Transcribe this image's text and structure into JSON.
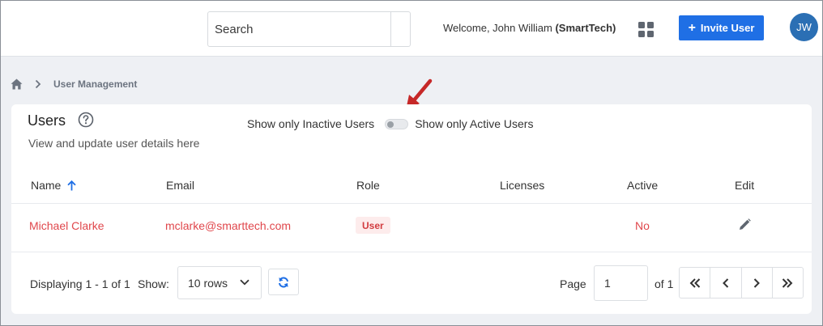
{
  "header": {
    "search": {
      "placeholder": "Search",
      "value": ""
    },
    "welcome_prefix": "Welcome, John William ",
    "welcome_org": "(SmartTech)",
    "apps_icon": "grid-icon",
    "invite_plus": "+",
    "invite_label": "Invite User",
    "avatar_initials": "JW",
    "accent_color": "#1f6fe5"
  },
  "breadcrumb": {
    "home_icon": "home-icon",
    "current": "User Management"
  },
  "card": {
    "title": "Users",
    "subtitle": "View and update user details here",
    "toggle": {
      "left_label": "Show only Inactive Users",
      "right_label": "Show only Active Users",
      "state": "inactive"
    }
  },
  "table": {
    "columns": [
      "Name",
      "Email",
      "Role",
      "Licenses",
      "Active",
      "Edit"
    ],
    "sort_column": "Name",
    "sort_direction": "ascending",
    "rows": [
      {
        "name": "Michael Clarke",
        "email": "mclarke@smarttech.com",
        "role": "User",
        "licenses": "",
        "active": "No"
      }
    ]
  },
  "footer": {
    "displaying": "Displaying 1 - 1 of 1",
    "show_label": "Show:",
    "rows_option": "10 rows",
    "page_label": "Page",
    "page_value": "1",
    "of_label": "of 1"
  }
}
